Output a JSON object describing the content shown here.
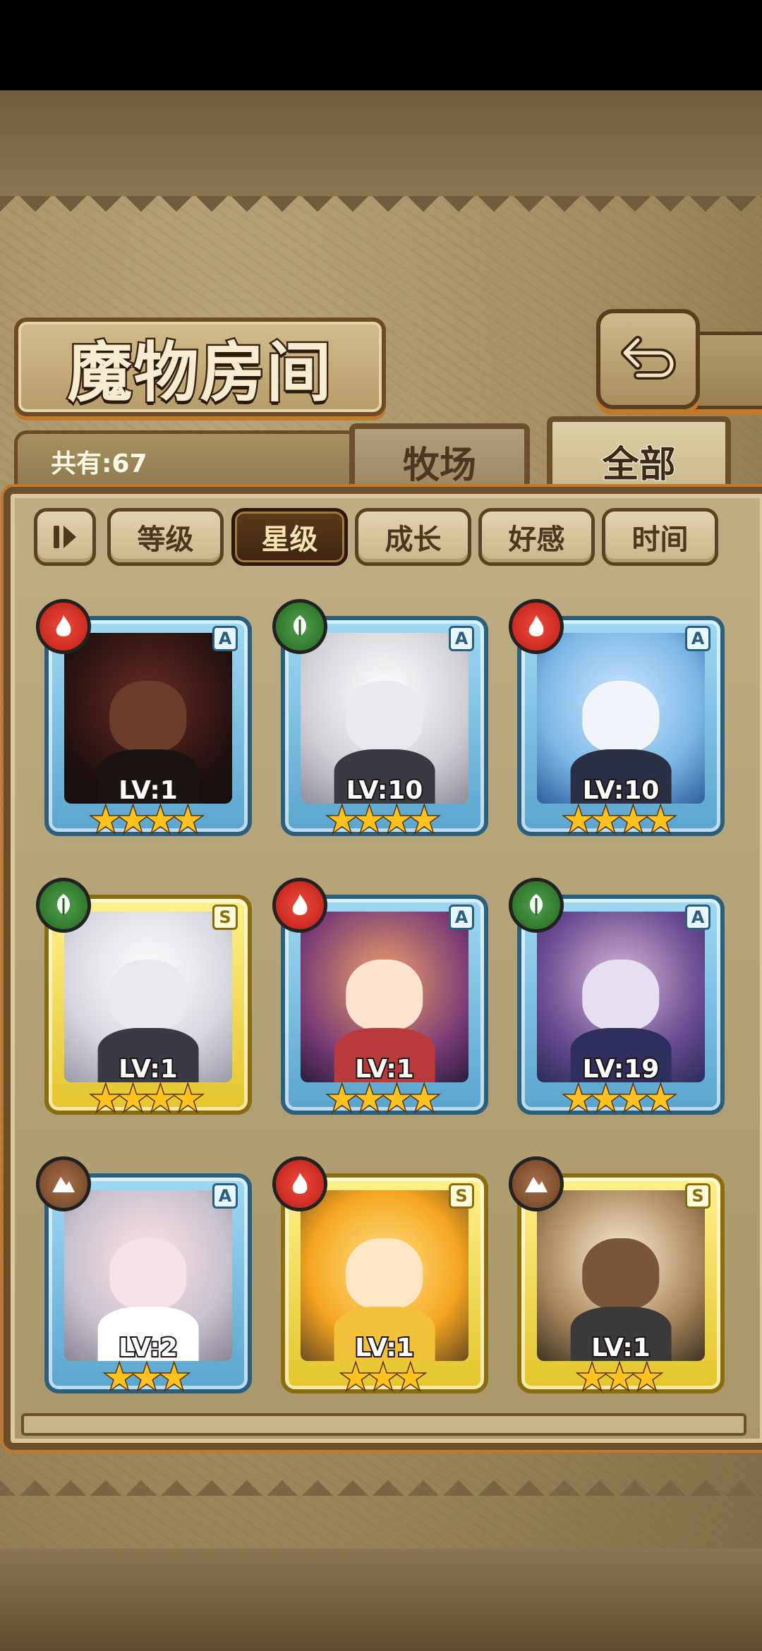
{
  "title": "魔物房间",
  "count_label": "共有:67",
  "tabs": {
    "pasture": "牧场",
    "all": "全部"
  },
  "sort_buttons": [
    "等级",
    "星级",
    "成长",
    "好感",
    "时间"
  ],
  "active_sort": "星级",
  "monsters": [
    {
      "level": "LV:1",
      "rank": "A",
      "element": "fire",
      "stars": "★★★★"
    },
    {
      "level": "LV:10",
      "rank": "A",
      "element": "leaf",
      "stars": "★★★★"
    },
    {
      "level": "LV:10",
      "rank": "A",
      "element": "fire",
      "stars": "★★★★"
    },
    {
      "level": "LV:1",
      "rank": "S",
      "element": "leaf",
      "stars": "★★★★"
    },
    {
      "level": "LV:1",
      "rank": "A",
      "element": "fire",
      "stars": "★★★★"
    },
    {
      "level": "LV:19",
      "rank": "A",
      "element": "leaf",
      "stars": "★★★★"
    },
    {
      "level": "LV:2",
      "rank": "A",
      "element": "earth",
      "stars": "★★★"
    },
    {
      "level": "LV:1",
      "rank": "S",
      "element": "fire",
      "stars": "★★★"
    },
    {
      "level": "LV:1",
      "rank": "S",
      "element": "earth",
      "stars": "★★★"
    }
  ],
  "colors": {
    "frame_a": "#5aa5cf",
    "frame_s": "#e4c52b",
    "fire": "#d42b20",
    "leaf": "#2f7d2a",
    "earth": "#8a5634",
    "star": "#ffc21f"
  }
}
